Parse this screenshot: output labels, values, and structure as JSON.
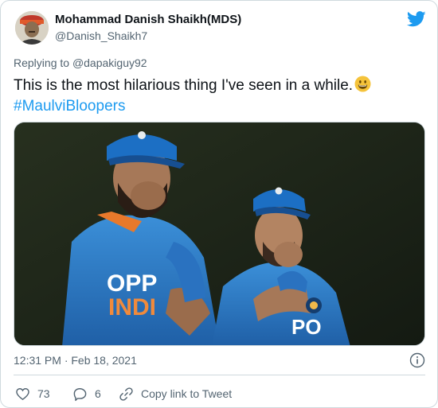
{
  "tweet": {
    "author_name": "Mohammad Danish Shaikh(MDS)",
    "author_handle": "@Danish_Shaikh7",
    "replying_prefix": "Replying to ",
    "replying_to": "@dapakiguy92",
    "text": "This is the most hilarious thing I've seen in a while.",
    "emoji": "grinning-face-emoji",
    "hashtag": "#MaulviBloopers",
    "timestamp": "12:31 PM · Feb 18, 2021",
    "likes": "73",
    "replies": "6",
    "copy_link_label": "Copy link to Tweet",
    "photo_text": {
      "jersey_sponsor_left": "OPP",
      "jersey_country_left": "INDI",
      "jersey_sponsor_right": "PO"
    }
  },
  "colors": {
    "accent": "#1d9bf0",
    "secondary_text": "#536471",
    "border": "#cfd9de"
  },
  "icons": [
    "twitter-bird-icon",
    "info-icon",
    "heart-icon",
    "reply-icon",
    "link-icon"
  ]
}
